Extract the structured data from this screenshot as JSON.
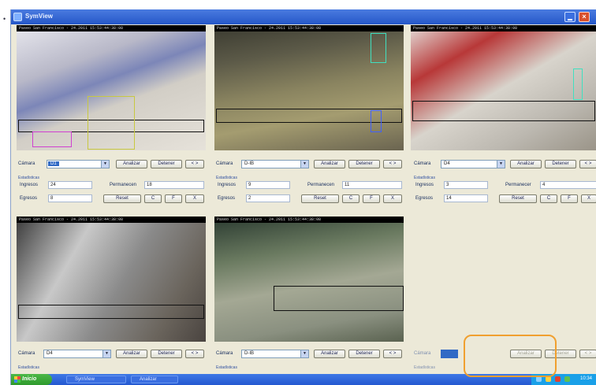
{
  "window": {
    "title": "SymView"
  },
  "cameras": [
    {
      "caption": "Paseo San Francisco - 24.2011 15:53:44:38:08",
      "camera_label": "Cámara",
      "camera_value": "D1",
      "buttons": [
        "Analizar",
        "Detener",
        "< >"
      ],
      "section": "Estadísticas",
      "stats": [
        {
          "label": "Ingresos",
          "value": "24"
        },
        {
          "label": "Permanecen",
          "value": "18"
        },
        {
          "label": "Egresos",
          "value": "8"
        }
      ],
      "actions": [
        "Reset",
        "C",
        "F",
        "X"
      ]
    },
    {
      "caption": "Paseo San Francisco - 24.2011 15:53:44:38:08",
      "camera_label": "Cámara",
      "camera_value": "D-IB",
      "buttons": [
        "Analizar",
        "Detener",
        "< >"
      ],
      "section": "Estadísticas",
      "stats": [
        {
          "label": "Ingresos",
          "value": "9"
        },
        {
          "label": "Permanecen",
          "value": "11"
        },
        {
          "label": "Egresos",
          "value": "2"
        }
      ],
      "actions": [
        "Reset",
        "C",
        "F",
        "X"
      ]
    },
    {
      "caption": "Paseo San Francisco - 24.2011 15:53:44:38:08",
      "camera_label": "Cámara",
      "camera_value": "D4",
      "buttons": [
        "Analizar",
        "Detener",
        "< >"
      ],
      "section": "Estadísticas",
      "stats": [
        {
          "label": "Ingresos",
          "value": "3"
        },
        {
          "label": "Permanecer",
          "value": "4"
        },
        {
          "label": "Egresos",
          "value": "14"
        }
      ],
      "actions": [
        "Reset",
        "C",
        "F",
        "X"
      ]
    },
    {
      "caption": "Paseo San Francisco - 24.2011 15:53:44:38:08",
      "camera_label": "Cámara",
      "camera_value": "D4",
      "buttons": [
        "Analizar",
        "Detener",
        "< >"
      ],
      "section": "Estadísticas"
    },
    {
      "caption": "Paseo San Francisco - 24.2011 15:53:44:38:08",
      "camera_label": "Cámara",
      "camera_value": "D-IB",
      "buttons": [
        "Analizar",
        "Detener",
        "< >"
      ],
      "section": "Estadísticas"
    }
  ],
  "empty_tile": {
    "label": "Cámara",
    "buttons": [
      "Analizar",
      "Detener",
      "< >"
    ],
    "section": "Estadísticas"
  },
  "taskbar": {
    "start": "Inicio",
    "tasks": [
      "SymView",
      "Analizar"
    ],
    "clock": "10:34"
  }
}
